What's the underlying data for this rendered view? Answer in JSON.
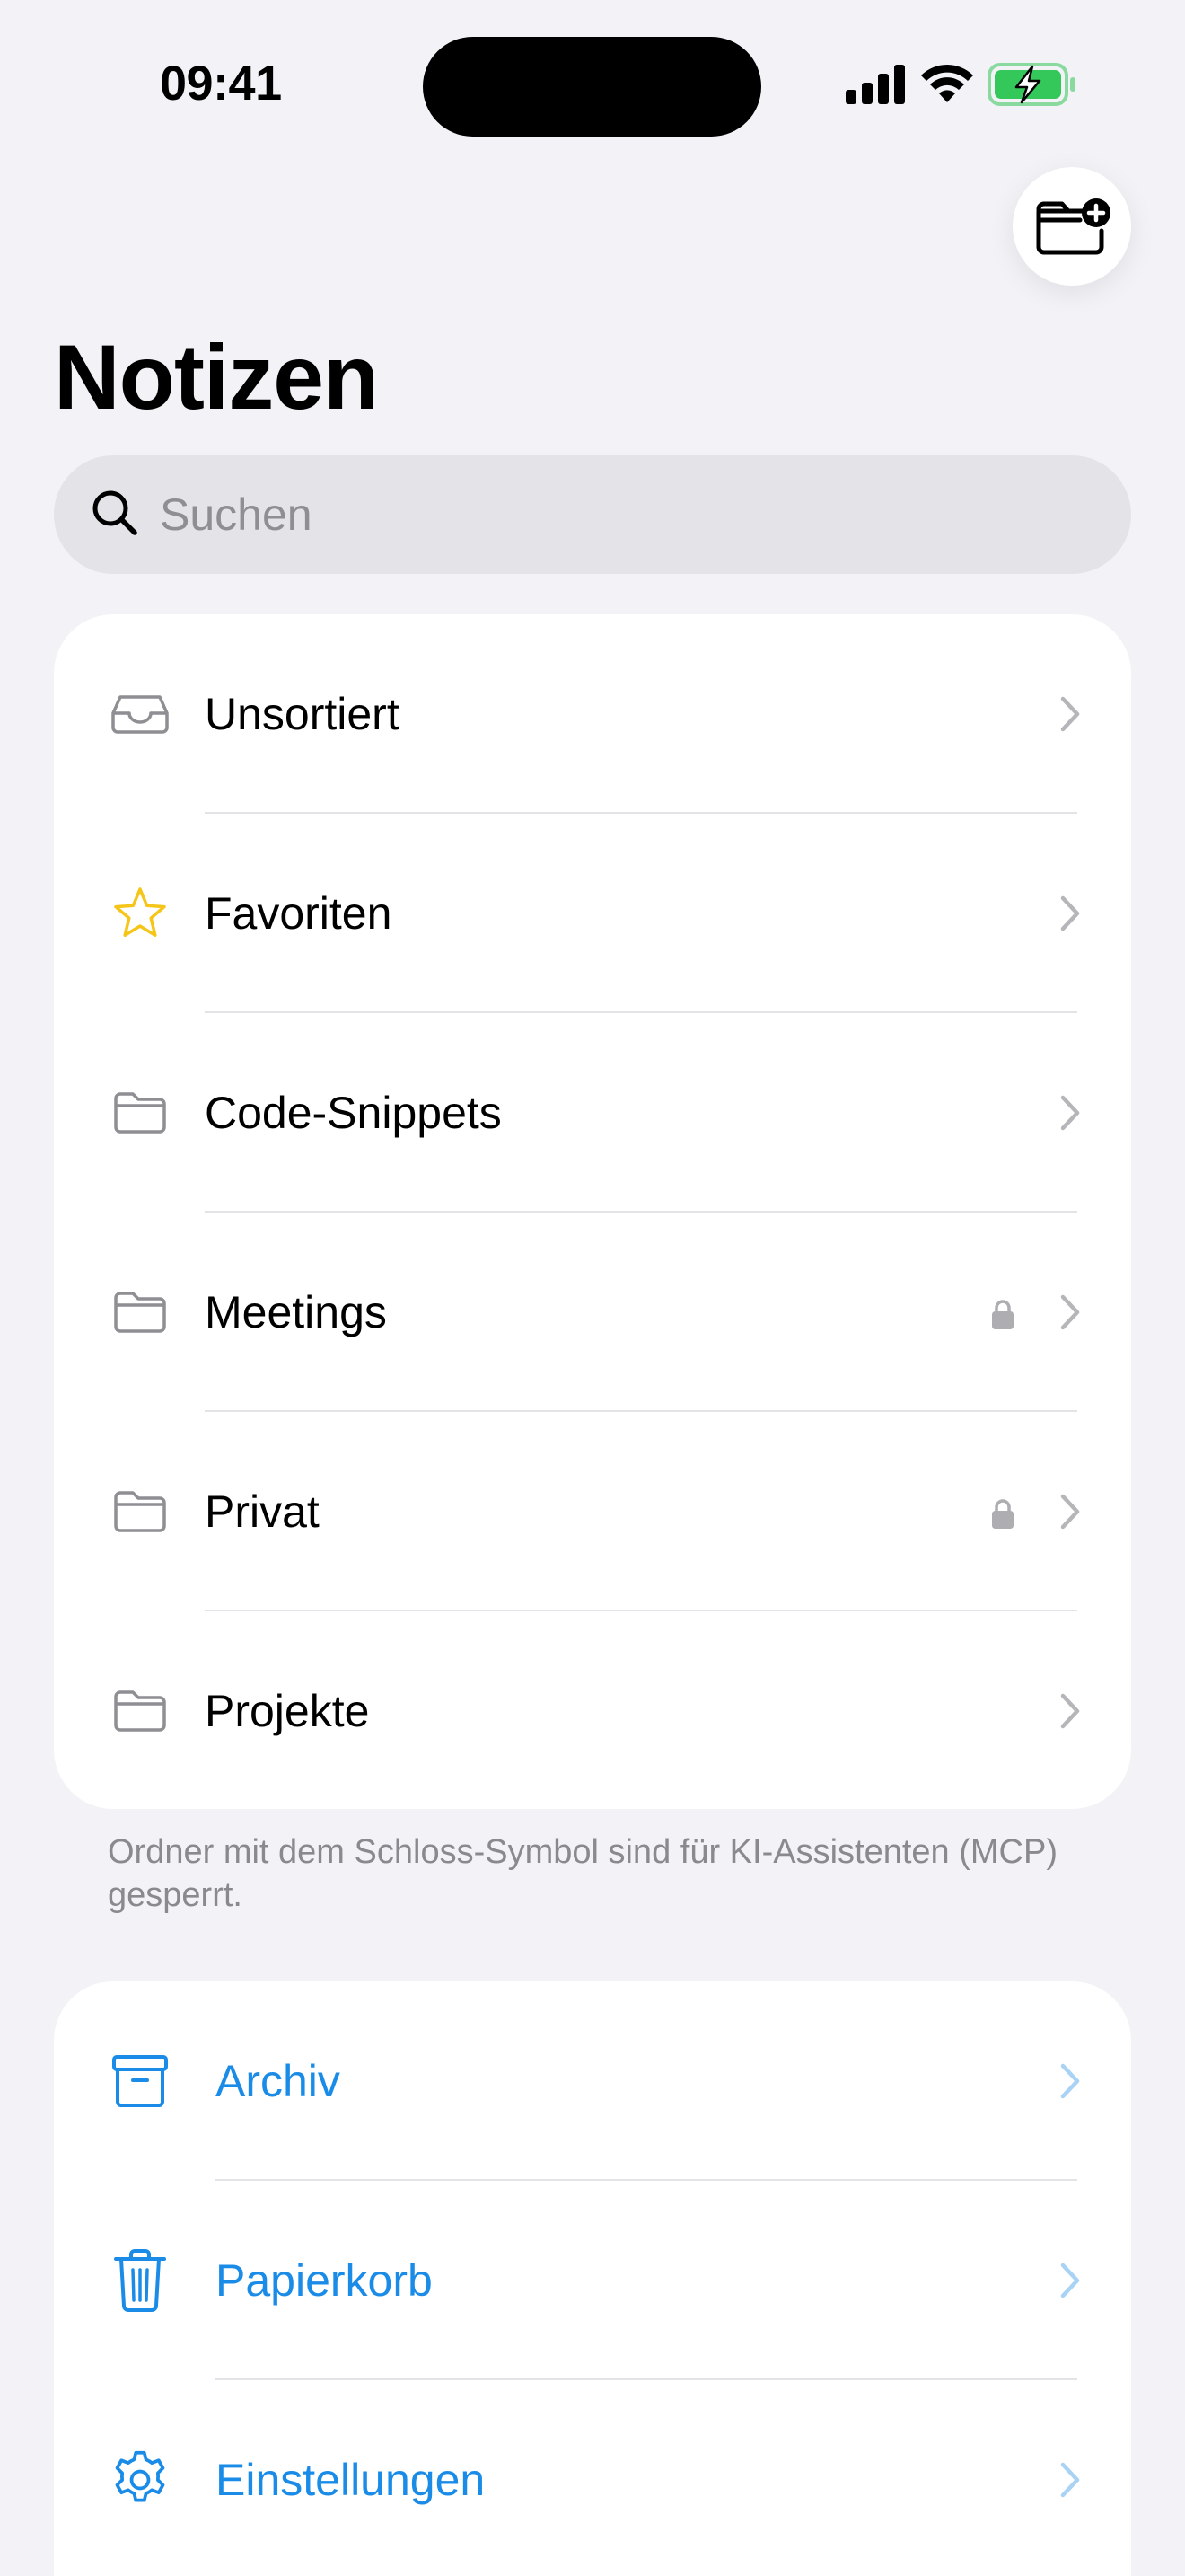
{
  "status_bar": {
    "time": "09:41"
  },
  "header": {
    "title": "Notizen"
  },
  "search": {
    "placeholder": "Suchen"
  },
  "folders": [
    {
      "label": "Unsortiert",
      "icon": "tray-icon",
      "locked": false
    },
    {
      "label": "Favoriten",
      "icon": "star-icon",
      "locked": false
    },
    {
      "label": "Code-Snippets",
      "icon": "folder-icon",
      "locked": false
    },
    {
      "label": "Meetings",
      "icon": "folder-icon",
      "locked": true
    },
    {
      "label": "Privat",
      "icon": "folder-icon",
      "locked": true
    },
    {
      "label": "Projekte",
      "icon": "folder-icon",
      "locked": false
    }
  ],
  "footnote": "Ordner mit dem Schloss-Symbol sind für KI-Assistenten (MCP) gesperrt.",
  "system_items": [
    {
      "label": "Archiv",
      "icon": "archive-box-icon"
    },
    {
      "label": "Papierkorb",
      "icon": "trash-icon"
    },
    {
      "label": "Einstellungen",
      "icon": "gear-icon"
    }
  ],
  "colors": {
    "accent": "#1A8CE8",
    "star": "#F5C518",
    "battery": "#34C759",
    "background": "#F2F2F7",
    "card": "#FFFFFF"
  }
}
